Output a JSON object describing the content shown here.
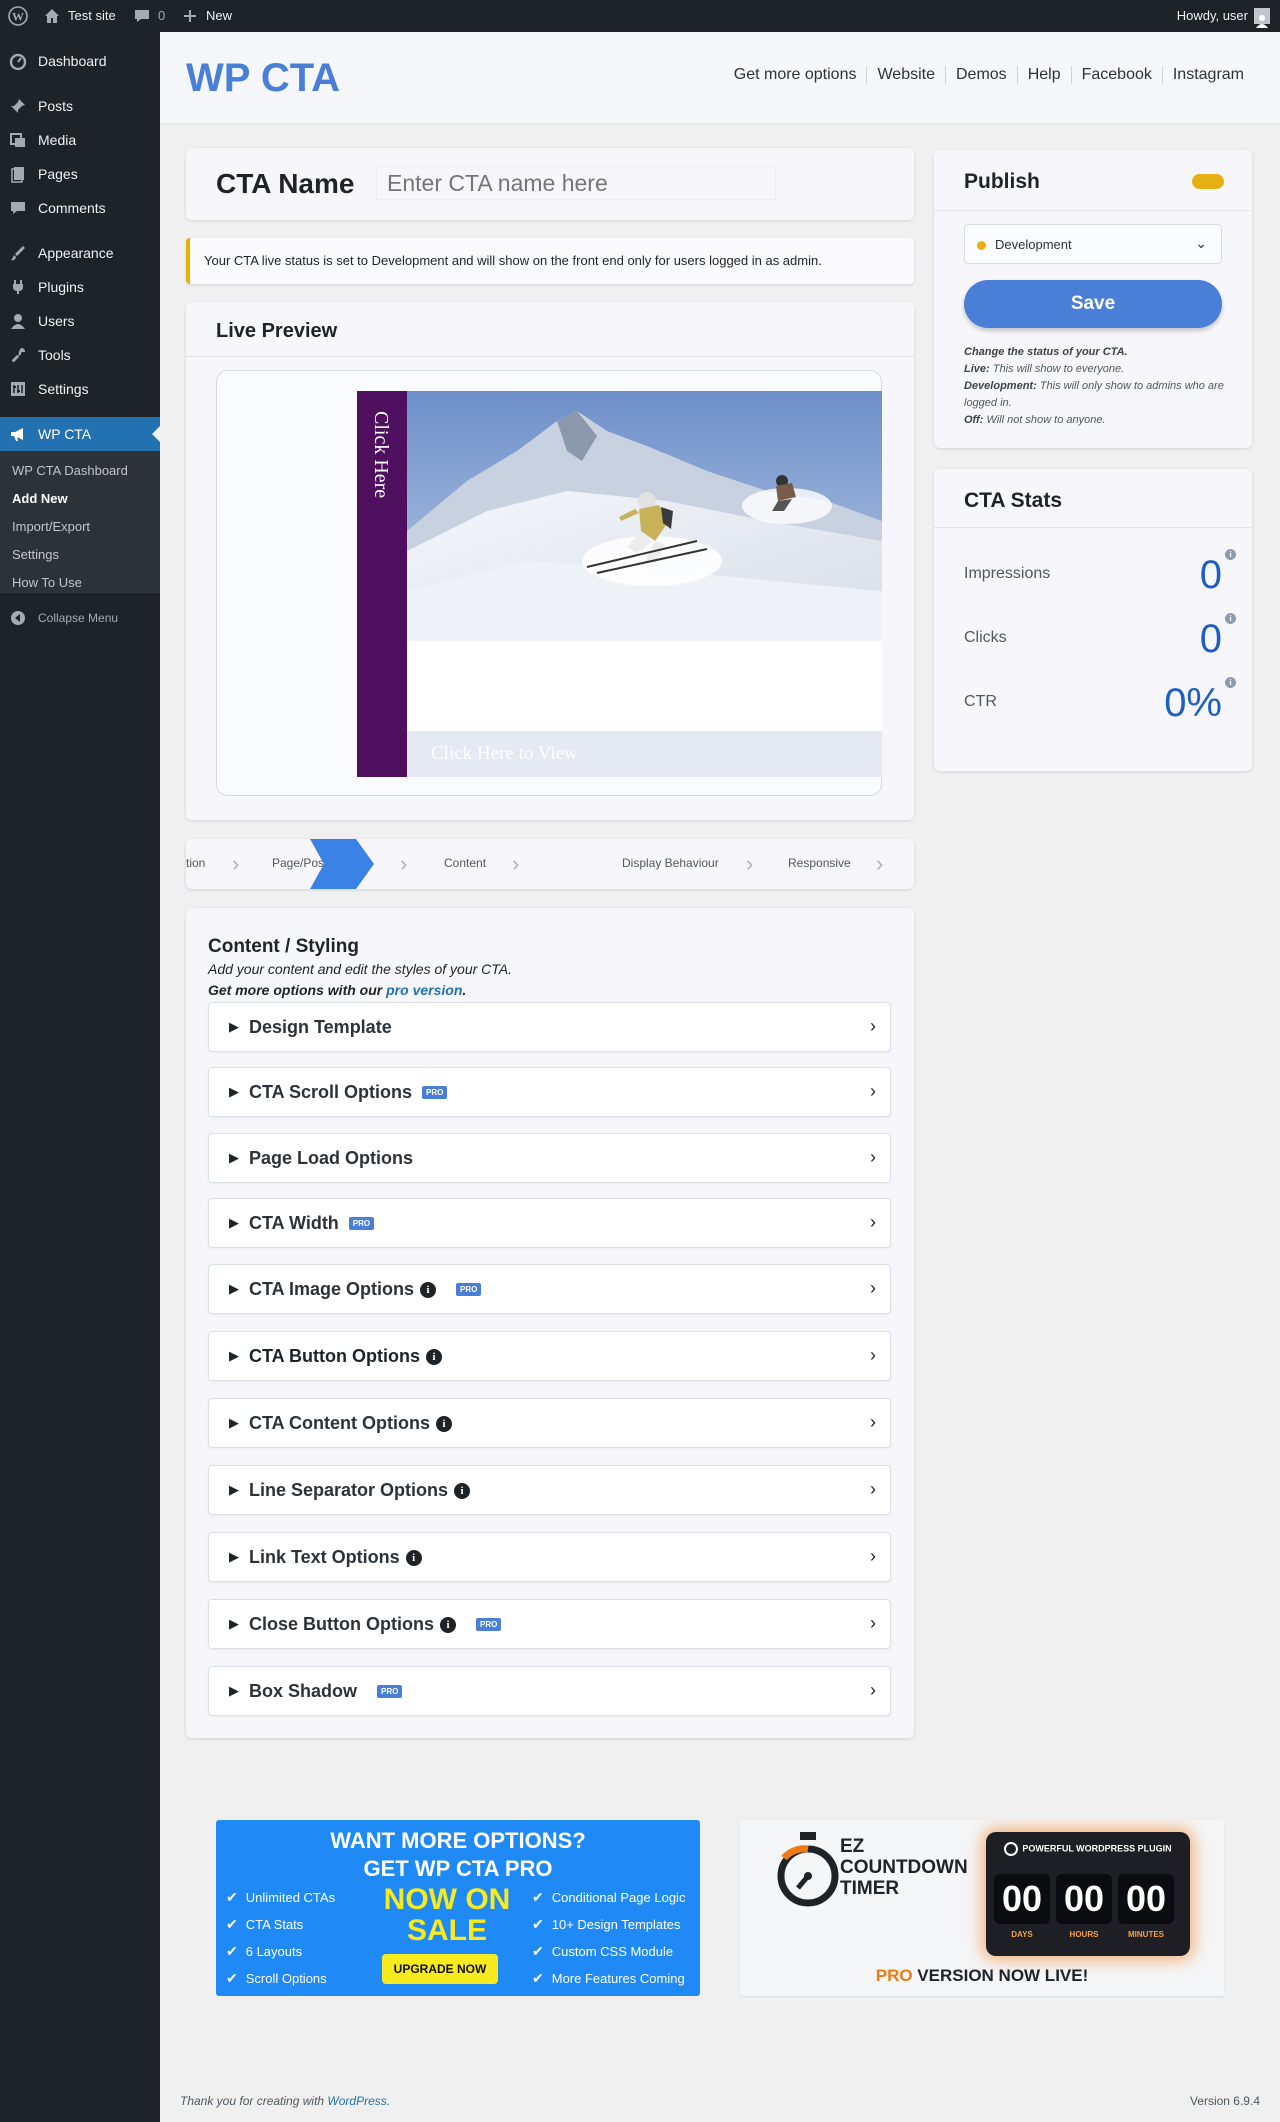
{
  "admin_bar": {
    "site_name": "Test site",
    "comments_count": "0",
    "new_label": "New",
    "howdy": "Howdy, user"
  },
  "sidebar": {
    "items": [
      {
        "label": "Dashboard",
        "icon": "dashboard-icon"
      },
      {
        "label": "Posts",
        "icon": "pin-icon"
      },
      {
        "label": "Media",
        "icon": "media-icon"
      },
      {
        "label": "Pages",
        "icon": "pages-icon"
      },
      {
        "label": "Comments",
        "icon": "comment-icon"
      },
      {
        "label": "Appearance",
        "icon": "brush-icon"
      },
      {
        "label": "Plugins",
        "icon": "plug-icon"
      },
      {
        "label": "Users",
        "icon": "user-icon"
      },
      {
        "label": "Tools",
        "icon": "wrench-icon"
      },
      {
        "label": "Settings",
        "icon": "settings-icon"
      },
      {
        "label": "WP CTA",
        "icon": "megaphone-icon"
      }
    ],
    "submenu": [
      "WP CTA Dashboard",
      "Add New",
      "Import/Export",
      "Settings",
      "How To Use"
    ],
    "collapse_label": "Collapse Menu"
  },
  "header": {
    "brand": "WP CTA",
    "nav": [
      "Get more options",
      "Website",
      "Demos",
      "Help",
      "Facebook",
      "Instagram"
    ]
  },
  "cta_name": {
    "label": "CTA Name",
    "placeholder": "Enter CTA name here",
    "value": ""
  },
  "notice": "Your CTA live status is set to Development and will show on the front end only for users logged in as admin.",
  "preview": {
    "title": "Live Preview",
    "side_text": "Click Here",
    "view_text": "Click Here to View"
  },
  "steps": [
    "tion",
    "Page/Pos",
    "Content",
    "Display Behaviour",
    "Responsive"
  ],
  "content_styling": {
    "title": "Content / Styling",
    "desc": "Add your content and edit the styles of your CTA.",
    "more_prefix": "Get more options with our ",
    "more_link": "pro version",
    "more_suffix": ".",
    "pro_label": "PRO",
    "sections": [
      {
        "label": "Design Template",
        "info": false,
        "pro": false
      },
      {
        "label": "CTA Scroll Options",
        "info": false,
        "pro": true
      },
      {
        "label": "Page Load Options",
        "info": false,
        "pro": false
      },
      {
        "label": "CTA Width",
        "info": false,
        "pro": true
      },
      {
        "label": "CTA Image Options",
        "info": true,
        "pro": true
      },
      {
        "label": "CTA Button Options",
        "info": true,
        "pro": false
      },
      {
        "label": "CTA Content Options",
        "info": true,
        "pro": false
      },
      {
        "label": "Line Separator Options",
        "info": true,
        "pro": false
      },
      {
        "label": "Link Text Options",
        "info": true,
        "pro": false
      },
      {
        "label": "Close Button Options",
        "info": true,
        "pro": true
      },
      {
        "label": "Box Shadow",
        "info": false,
        "pro": true
      }
    ]
  },
  "publish": {
    "title": "Publish",
    "status": "Development",
    "save_label": "Save",
    "help_title": "Change the status of your CTA.",
    "help_live_label": "Live:",
    "help_live": " This will show to everyone.",
    "help_dev_label": "Development:",
    "help_dev": " This will only show to admins who are logged in.",
    "help_off_label": "Off:",
    "help_off": " Will not show to anyone."
  },
  "stats": {
    "title": "CTA Stats",
    "rows": [
      {
        "label": "Impressions",
        "value": "0"
      },
      {
        "label": "Clicks",
        "value": "0"
      },
      {
        "label": "CTR",
        "value": "0%"
      }
    ]
  },
  "banner_pro": {
    "line1": "WANT MORE OPTIONS?",
    "line2": "GET WP CTA PRO",
    "left_list": [
      "Unlimited CTAs",
      "CTA Stats",
      "6 Layouts",
      "Scroll Options"
    ],
    "sale": "NOW ON SALE",
    "button": "UPGRADE NOW",
    "right_list": [
      "Conditional Page Logic",
      "10+ Design Templates",
      "Custom CSS Module",
      "More Features Coming"
    ]
  },
  "banner_timer": {
    "title_lines": [
      "EZ",
      "COUNTDOWN",
      "TIMER"
    ],
    "tag": "POWERFUL WORDPRESS PLUGIN",
    "digits": [
      "00",
      "00",
      "00"
    ],
    "units": [
      "DAYS",
      "HOURS",
      "MINUTES"
    ],
    "bottom_pro": "PRO",
    "bottom_rest": " VERSION NOW LIVE!"
  },
  "footer": {
    "thanks_prefix": "Thank you for creating with ",
    "thanks_link": "WordPress",
    "thanks_suffix": ".",
    "version": "Version 6.9.4"
  }
}
